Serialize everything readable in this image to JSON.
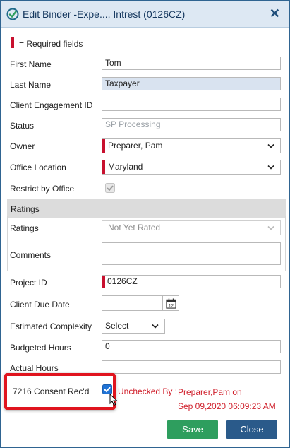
{
  "dialog": {
    "title": "Edit Binder -Expe..., Intrest (0126CZ)",
    "required_note": "= Required fields"
  },
  "fields": {
    "first_name": {
      "label": "First Name",
      "value": "Tom"
    },
    "last_name": {
      "label": "Last Name",
      "value": "Taxpayer"
    },
    "client_engagement_id": {
      "label": "Client Engagement ID",
      "value": ""
    },
    "status": {
      "label": "Status",
      "value": "SP Processing"
    },
    "owner": {
      "label": "Owner",
      "value": "Preparer, Pam"
    },
    "office_location": {
      "label": "Office Location",
      "value": "Maryland"
    },
    "restrict_by_office": {
      "label": "Restrict by Office",
      "checked": true
    }
  },
  "ratings_section": {
    "header": "Ratings",
    "ratings": {
      "label": "Ratings",
      "value": "Not Yet Rated"
    },
    "comments": {
      "label": "Comments",
      "value": ""
    }
  },
  "project": {
    "project_id": {
      "label": "Project ID",
      "value": "0126CZ"
    },
    "client_due_date": {
      "label": "Client Due Date",
      "value": ""
    },
    "estimated_complexity": {
      "label": "Estimated Complexity",
      "value": "Select"
    },
    "budgeted_hours": {
      "label": "Budgeted Hours",
      "value": "0"
    },
    "actual_hours": {
      "label": "Actual Hours",
      "value": ""
    },
    "consent": {
      "label": "7216 Consent Rec'd",
      "checked": true,
      "status_prefix": "Unchecked By :",
      "status_user": "Preparer,Pam on",
      "status_date": "Sep 09,2020 06:09:23 AM"
    }
  },
  "buttons": {
    "save": "Save",
    "close": "Close"
  },
  "colors": {
    "accent": "#2f6491",
    "required": "#c8102e",
    "save": "#2e9e5e",
    "close": "#2a5a8a",
    "highlight_box": "#e0141e"
  },
  "icons": {
    "title": "check-circle-icon",
    "close": "close-icon",
    "calendar": "calendar-icon",
    "cursor": "mouse-pointer-icon"
  }
}
